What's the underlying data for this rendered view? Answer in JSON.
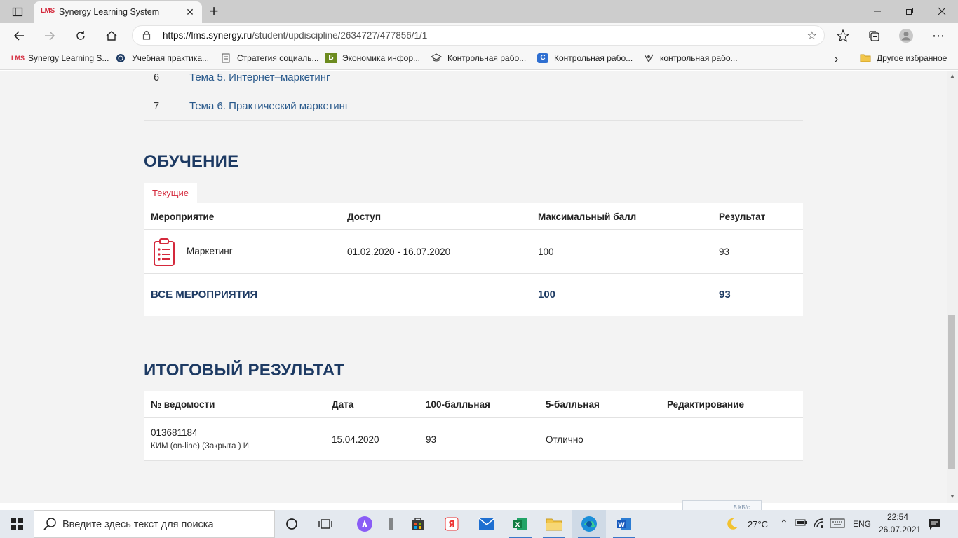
{
  "browser": {
    "tab": {
      "favicon_text": "LMS",
      "title": "Synergy Learning System"
    },
    "address": {
      "url_host": "https://lms.synergy.ru",
      "url_path": "/student/updiscipline/2634727/477856/1/1"
    },
    "bookmarks": [
      {
        "label": "Synergy Learning S...",
        "icon": "lms-icon"
      },
      {
        "label": "Учебная практика...",
        "icon": "globe-icon"
      },
      {
        "label": "Стратегия социаль...",
        "icon": "document-icon"
      },
      {
        "label": "Экономика инфор...",
        "icon": "b-icon"
      },
      {
        "label": "Контрольная рабо...",
        "icon": "cap-icon"
      },
      {
        "label": "Контрольная рабо...",
        "icon": "c-icon"
      },
      {
        "label": "контрольная рабо...",
        "icon": "badge-icon"
      }
    ],
    "other_favorites": "Другое избранное"
  },
  "topics": [
    {
      "num": "6",
      "title": "Тема 5. Интернет–маркетинг"
    },
    {
      "num": "7",
      "title": "Тема 6. Практический маркетинг"
    }
  ],
  "training": {
    "title": "ОБУЧЕНИЕ",
    "tab_current": "Текущие",
    "headers": {
      "event": "Мероприятие",
      "access": "Доступ",
      "max": "Максимальный балл",
      "result": "Результат"
    },
    "row": {
      "event": "Маркетинг",
      "access": "01.02.2020 - 16.07.2020",
      "max": "100",
      "result": "93"
    },
    "summary": {
      "label": "ВСЕ МЕРОПРИЯТИЯ",
      "max": "100",
      "result": "93"
    }
  },
  "final": {
    "title": "ИТОГОВЫЙ РЕЗУЛЬТАТ",
    "headers": {
      "statement": "№ ведомости",
      "date": "Дата",
      "score100": "100-балльная",
      "score5": "5-балльная",
      "edit": "Редактирование"
    },
    "row": {
      "statement": "013681184",
      "statement_sub": "КИМ (on-line) (Закрыта ) И",
      "date": "15.04.2020",
      "score100": "93",
      "score5": "Отлично",
      "edit": ""
    }
  },
  "taskbar": {
    "search_placeholder": "Введите здесь текст для поиска",
    "weather": "27°C",
    "lang": "ENG",
    "time": "22:54",
    "date": "26.07.2021",
    "net_speed": "5 КБ/с"
  },
  "colors": {
    "accent_red": "#d4293c",
    "heading_navy": "#1d3a63",
    "link_blue": "#2a5a8c"
  }
}
